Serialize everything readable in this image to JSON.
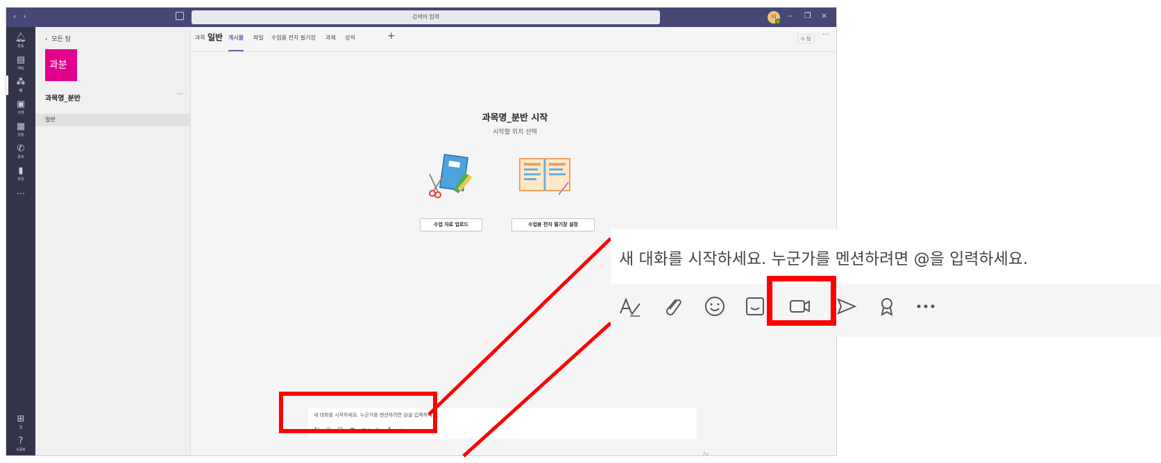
{
  "titlebar": {
    "search_placeholder": "검색어 입력",
    "avatar_initial": "이"
  },
  "rail": {
    "items": [
      {
        "label": "활동",
        "icon": "bell-icon"
      },
      {
        "label": "채팅",
        "icon": "chat-icon"
      },
      {
        "label": "팀",
        "icon": "teams-icon"
      },
      {
        "label": "과제",
        "icon": "assignments-icon"
      },
      {
        "label": "일정",
        "icon": "calendar-icon"
      },
      {
        "label": "통화",
        "icon": "phone-icon"
      },
      {
        "label": "파일",
        "icon": "file-icon"
      }
    ],
    "more": "···",
    "apps_label": "앱",
    "help_label": "도움말"
  },
  "team_panel": {
    "back_label": "모든 팀",
    "team_avatar_text": "과분",
    "team_name": "과목명_분반",
    "more": "···",
    "channel": "일반"
  },
  "tabs": {
    "course_label": "과목",
    "channel_title": "일반",
    "items": [
      "게시물",
      "파일",
      "수업용 전자 필기장",
      "과제",
      "성적"
    ],
    "active_index": 0,
    "add": "+",
    "team_button": "⊙ 팀",
    "more": "···"
  },
  "welcome": {
    "title": "과목명_분반 시작",
    "subtitle": "시작할 위치 선택",
    "upload_button": "수업 자료 업로드",
    "notebook_button": "수업용 전자 필기장 설정"
  },
  "composer": {
    "placeholder": "새 대화를 시작하세요. 누군가를 멘션하려면 @을 입력하세요.",
    "tools": [
      "format-icon",
      "attach-icon",
      "emoji-icon",
      "sticker-icon",
      "meet-now-icon",
      "send-icon",
      "praise-icon",
      "more-icon"
    ]
  },
  "zoom_callout": {
    "placeholder": "새 대화를 시작하세요. 누군가를 멘션하려면 @을 입력하세요.",
    "highlighted_tool": "meet-now-icon",
    "highlight_color": "#ff0000"
  },
  "colors": {
    "titlebar": "#464775",
    "rail": "#33344a",
    "accent": "#6264a7",
    "team_avatar": "#e3008c"
  }
}
